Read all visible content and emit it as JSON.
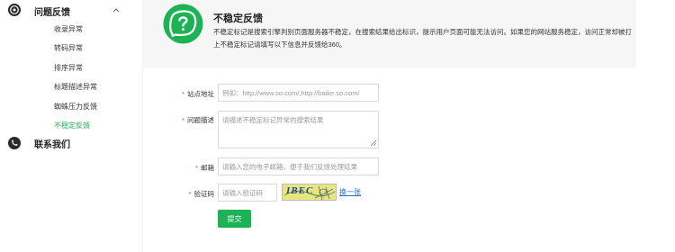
{
  "sidebar": {
    "group_label": "问题反馈",
    "items": [
      {
        "label": "收录异常"
      },
      {
        "label": "转码异常"
      },
      {
        "label": "排序异常"
      },
      {
        "label": "标题描述异常"
      },
      {
        "label": "蜘蛛压力反馈"
      },
      {
        "label": "不稳定反馈"
      }
    ],
    "contact_label": "联系我们"
  },
  "banner": {
    "title": "不稳定反馈",
    "desc": "不稳定标记是搜索引擎判别页面服务器不稳定，在搜索结果给出标识，提示用户页面可能无法访问。如果您的网站服务稳定，访问正常却被打上不稳定标记请填写以下信息并反馈给360。"
  },
  "form": {
    "site": {
      "label": "站点地址",
      "placeholder": "例如：http://www.so.com/,http://baike.so.com/"
    },
    "problem": {
      "label": "问题描述",
      "placeholder": "请描述不稳定标记异常的搜索结果"
    },
    "email": {
      "label": "邮箱",
      "placeholder": "请输入您的电子邮箱，便于我们反馈处理结果"
    },
    "captcha": {
      "label": "验证码",
      "placeholder": "请输入验证码",
      "image_text": "IBEC",
      "refresh": "换一张"
    },
    "submit": "提交"
  },
  "colors": {
    "accent": "#1db254",
    "link": "#2e6bd3",
    "required": "#ee4444"
  }
}
